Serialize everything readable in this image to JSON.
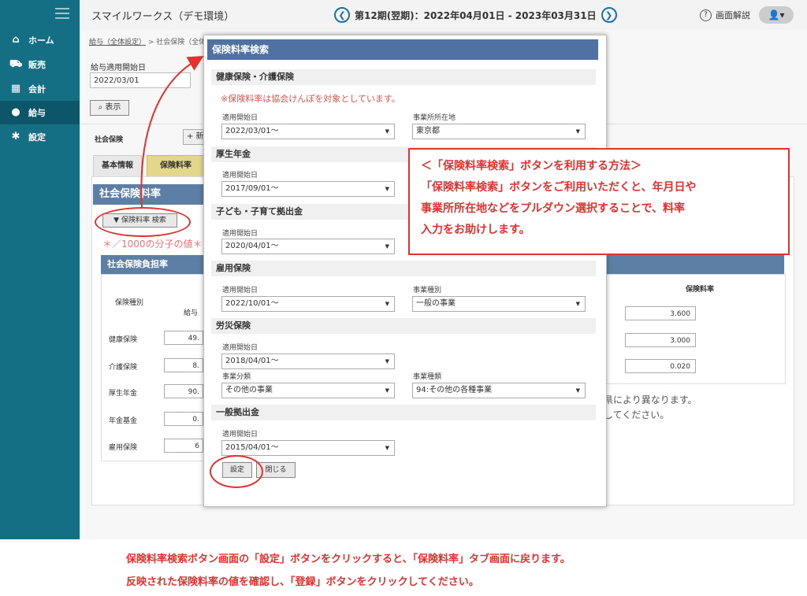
{
  "header": {
    "app_title": "スマイルワークス（デモ環境）",
    "period": "第12期(翌期)：2022年04月01日 - 2023年03月31日",
    "prev_icon": "chevron-left-icon",
    "next_icon": "chevron-right-icon",
    "help_label": "画面解説",
    "user_icon": "user-icon"
  },
  "sidebar": {
    "items": [
      {
        "label": "ホーム",
        "icon": "home-icon"
      },
      {
        "label": "販売",
        "icon": "cart-icon"
      },
      {
        "label": "会計",
        "icon": "calculator-icon"
      },
      {
        "label": "給与",
        "icon": "money-bag-icon"
      },
      {
        "label": "設定",
        "icon": "gear-icon"
      }
    ],
    "active": "給与"
  },
  "page": {
    "breadcrumb_link": "給与（全体設定）",
    "breadcrumb_rest": " > 社会保険（全体",
    "start_label": "給与適用開始日",
    "start_value": "2022/03/01",
    "show_button": "表示",
    "shakai_label": "社会保険",
    "add_button": "+ 新",
    "tabs": [
      "基本情報",
      "保険料率"
    ],
    "rate_header": "社会保険料率",
    "rate_search_button": "▼ 保険料率 検索",
    "note_1000": "＊／1000の分子の値＊を",
    "burden_header": "社会保険負担率",
    "col_shubetsu": "保険種別",
    "col_kyuyo": "給与",
    "rows": [
      {
        "label": "健康保険",
        "value": "49."
      },
      {
        "label": "介護保険",
        "value": "8."
      },
      {
        "label": "厚生年金",
        "value": "90."
      },
      {
        "label": "年金基金",
        "value": "0."
      },
      {
        "label": "雇用保険",
        "value": "6"
      }
    ],
    "rate_col_head": "保険料率",
    "rates": [
      "3.600",
      "3.000",
      "0.020"
    ],
    "side_note_1": "県により異なります。",
    "side_note_2": "してください。"
  },
  "modal": {
    "title": "保険料率検索",
    "notice": "※保険料率は協会けんぽを対象としています。",
    "sections": {
      "health": "健康保険・介護保険",
      "pension": "厚生年金",
      "child": "子ども・子育て拠出金",
      "employment": "雇用保険",
      "accident": "労災保険",
      "general": "一般拠出金"
    },
    "label_start": "適用開始日",
    "label_location": "事業所所在地",
    "label_business_type": "事業種別",
    "label_business_class": "事業分類",
    "label_business_kind": "事業種類",
    "health_start": "2022/03/01〜",
    "location": "東京都",
    "pension_start": "2017/09/01〜",
    "child_start": "2020/04/01〜",
    "employment_start": "2022/10/01〜",
    "business_type": "一般の事業",
    "accident_start": "2018/04/01〜",
    "business_class": "その他の事業",
    "business_kind": "94:その他の各種事業",
    "general_start": "2015/04/01〜",
    "set_button": "設定",
    "close_button": "閉じる"
  },
  "annotation": {
    "callout_title": "＜「保険料率検索」ボタンを利用する方法＞",
    "callout_line1": "「保険料率検索」ボタンをご利用いただくと、年月日や",
    "callout_line2": "事業所所在地などをプルダウン選択することで、料率",
    "callout_line3": "入力をお助けします。",
    "caption_line1": "保険料率検索ボタン画面の「設定」ボタンをクリックすると、「保険料率」タブ画面に戻ります。",
    "caption_line2": "反映された保険料率の値を確認し、「登録」ボタンをクリックしてください。",
    "accent": "#e0322f"
  }
}
